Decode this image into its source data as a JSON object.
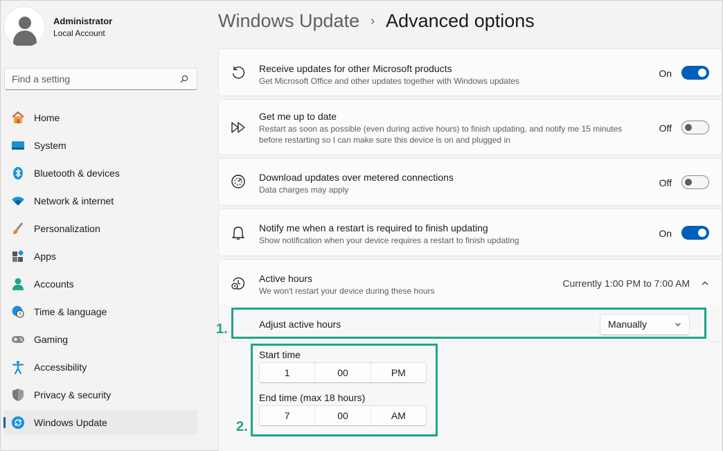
{
  "user": {
    "name": "Administrator",
    "account": "Local Account"
  },
  "search": {
    "placeholder": "Find a setting"
  },
  "nav": [
    {
      "label": "Home",
      "icon": "home-icon"
    },
    {
      "label": "System",
      "icon": "system-icon"
    },
    {
      "label": "Bluetooth & devices",
      "icon": "bluetooth-icon"
    },
    {
      "label": "Network & internet",
      "icon": "wifi-icon"
    },
    {
      "label": "Personalization",
      "icon": "brush-icon"
    },
    {
      "label": "Apps",
      "icon": "apps-icon"
    },
    {
      "label": "Accounts",
      "icon": "accounts-icon"
    },
    {
      "label": "Time & language",
      "icon": "globe-clock-icon"
    },
    {
      "label": "Gaming",
      "icon": "gamepad-icon"
    },
    {
      "label": "Accessibility",
      "icon": "accessibility-icon"
    },
    {
      "label": "Privacy & security",
      "icon": "shield-icon"
    },
    {
      "label": "Windows Update",
      "icon": "update-icon"
    }
  ],
  "header": {
    "crumb_parent": "Windows Update",
    "separator": "›",
    "crumb_current": "Advanced options"
  },
  "settings": [
    {
      "title": "Receive updates for other Microsoft products",
      "subtitle": "Get Microsoft Office and other updates together with Windows updates",
      "state": "On",
      "icon": "refresh-icon"
    },
    {
      "title": "Get me up to date",
      "subtitle": "Restart as soon as possible (even during active hours) to finish updating, and notify me 15 minutes",
      "subtitle2": "before restarting so I can make sure this device is on and plugged in",
      "state": "Off",
      "icon": "fast-forward-icon"
    },
    {
      "title": "Download updates over metered connections",
      "subtitle": "Data charges may apply",
      "state": "Off",
      "icon": "gauge-icon"
    },
    {
      "title": "Notify me when a restart is required to finish updating",
      "subtitle": "Show notification when your device requires a restart to finish updating",
      "state": "On",
      "icon": "bell-icon"
    }
  ],
  "active_hours": {
    "title": "Active hours",
    "subtitle": "We won't restart your device during these hours",
    "current": "Currently 1:00 PM to 7:00 AM",
    "adjust_label": "Adjust active hours",
    "adjust_value": "Manually",
    "start_label": "Start time",
    "start": {
      "hour": "1",
      "minute": "00",
      "period": "PM"
    },
    "end_label": "End time (max 18 hours)",
    "end": {
      "hour": "7",
      "minute": "00",
      "period": "AM"
    }
  },
  "annotations": {
    "first": "1.",
    "second": "2."
  },
  "colors": {
    "accent": "#005fb8",
    "highlight": "#1ea58a"
  }
}
